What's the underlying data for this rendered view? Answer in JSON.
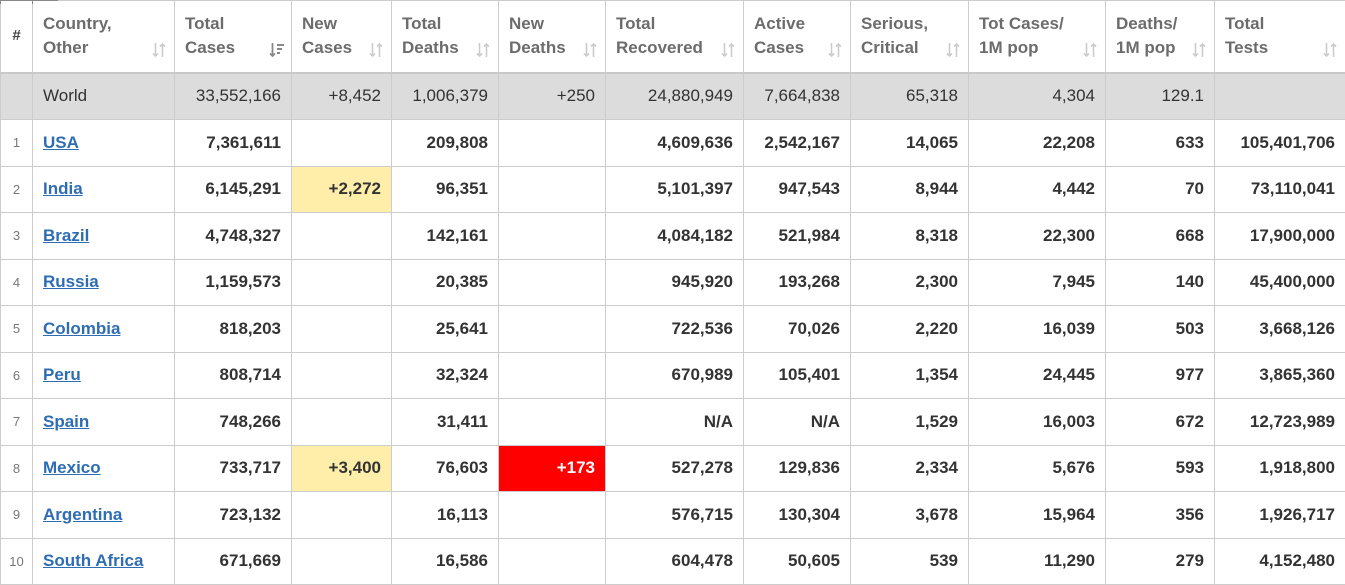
{
  "colors": {
    "link": "#2e6db4",
    "world_row_bg": "#dcdcdc",
    "new_cases_highlight": "#ffeeaa",
    "new_deaths_highlight": "#ff0000"
  },
  "headers": {
    "index": "#",
    "country": [
      "Country,",
      "Other"
    ],
    "total_cases": [
      "Total",
      "Cases"
    ],
    "new_cases": [
      "New",
      "Cases"
    ],
    "total_deaths": [
      "Total",
      "Deaths"
    ],
    "new_deaths": [
      "New",
      "Deaths"
    ],
    "total_recovered": [
      "Total",
      "Recovered"
    ],
    "active_cases": [
      "Active",
      "Cases"
    ],
    "serious_critical": [
      "Serious,",
      "Critical"
    ],
    "cases_per_million": [
      "Tot Cases/",
      "1M pop"
    ],
    "deaths_per_million": [
      "Deaths/",
      "1M pop"
    ],
    "total_tests": [
      "Total",
      "Tests"
    ]
  },
  "sort_icons": {
    "default": "sort-arrows-icon",
    "active": "sort-descending-icon"
  },
  "world": {
    "country": "World",
    "total_cases": "33,552,166",
    "new_cases": "+8,452",
    "total_deaths": "1,006,379",
    "new_deaths": "+250",
    "total_recovered": "24,880,949",
    "active_cases": "7,664,838",
    "serious_critical": "65,318",
    "cases_per_million": "4,304",
    "deaths_per_million": "129.1",
    "total_tests": ""
  },
  "rows": [
    {
      "index": "1",
      "country": "USA",
      "total_cases": "7,361,611",
      "new_cases": "",
      "total_deaths": "209,808",
      "new_deaths": "",
      "total_recovered": "4,609,636",
      "active_cases": "2,542,167",
      "serious_critical": "14,065",
      "cases_per_million": "22,208",
      "deaths_per_million": "633",
      "total_tests": "105,401,706"
    },
    {
      "index": "2",
      "country": "India",
      "total_cases": "6,145,291",
      "new_cases": "+2,272",
      "total_deaths": "96,351",
      "new_deaths": "",
      "total_recovered": "5,101,397",
      "active_cases": "947,543",
      "serious_critical": "8,944",
      "cases_per_million": "4,442",
      "deaths_per_million": "70",
      "total_tests": "73,110,041"
    },
    {
      "index": "3",
      "country": "Brazil",
      "total_cases": "4,748,327",
      "new_cases": "",
      "total_deaths": "142,161",
      "new_deaths": "",
      "total_recovered": "4,084,182",
      "active_cases": "521,984",
      "serious_critical": "8,318",
      "cases_per_million": "22,300",
      "deaths_per_million": "668",
      "total_tests": "17,900,000"
    },
    {
      "index": "4",
      "country": "Russia",
      "total_cases": "1,159,573",
      "new_cases": "",
      "total_deaths": "20,385",
      "new_deaths": "",
      "total_recovered": "945,920",
      "active_cases": "193,268",
      "serious_critical": "2,300",
      "cases_per_million": "7,945",
      "deaths_per_million": "140",
      "total_tests": "45,400,000"
    },
    {
      "index": "5",
      "country": "Colombia",
      "total_cases": "818,203",
      "new_cases": "",
      "total_deaths": "25,641",
      "new_deaths": "",
      "total_recovered": "722,536",
      "active_cases": "70,026",
      "serious_critical": "2,220",
      "cases_per_million": "16,039",
      "deaths_per_million": "503",
      "total_tests": "3,668,126"
    },
    {
      "index": "6",
      "country": "Peru",
      "total_cases": "808,714",
      "new_cases": "",
      "total_deaths": "32,324",
      "new_deaths": "",
      "total_recovered": "670,989",
      "active_cases": "105,401",
      "serious_critical": "1,354",
      "cases_per_million": "24,445",
      "deaths_per_million": "977",
      "total_tests": "3,865,360"
    },
    {
      "index": "7",
      "country": "Spain",
      "total_cases": "748,266",
      "new_cases": "",
      "total_deaths": "31,411",
      "new_deaths": "",
      "total_recovered": "N/A",
      "active_cases": "N/A",
      "serious_critical": "1,529",
      "cases_per_million": "16,003",
      "deaths_per_million": "672",
      "total_tests": "12,723,989"
    },
    {
      "index": "8",
      "country": "Mexico",
      "total_cases": "733,717",
      "new_cases": "+3,400",
      "total_deaths": "76,603",
      "new_deaths": "+173",
      "total_recovered": "527,278",
      "active_cases": "129,836",
      "serious_critical": "2,334",
      "cases_per_million": "5,676",
      "deaths_per_million": "593",
      "total_tests": "1,918,800"
    },
    {
      "index": "9",
      "country": "Argentina",
      "total_cases": "723,132",
      "new_cases": "",
      "total_deaths": "16,113",
      "new_deaths": "",
      "total_recovered": "576,715",
      "active_cases": "130,304",
      "serious_critical": "3,678",
      "cases_per_million": "15,964",
      "deaths_per_million": "356",
      "total_tests": "1,926,717"
    },
    {
      "index": "10",
      "country": "South Africa",
      "total_cases": "671,669",
      "new_cases": "",
      "total_deaths": "16,586",
      "new_deaths": "",
      "total_recovered": "604,478",
      "active_cases": "50,605",
      "serious_critical": "539",
      "cases_per_million": "11,290",
      "deaths_per_million": "279",
      "total_tests": "4,152,480"
    }
  ]
}
